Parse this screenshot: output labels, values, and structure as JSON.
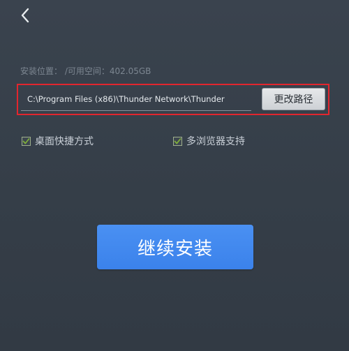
{
  "nav": {
    "back_icon": "chevron-left-icon"
  },
  "location": {
    "label": "安装位置：",
    "space_label": "/可用空间：402.05GB"
  },
  "path": {
    "value": "C:\\Program Files (x86)\\Thunder Network\\Thunder",
    "change_button": "更改路径",
    "highlight_color": "#e3262e"
  },
  "options": {
    "desktop_shortcut": {
      "label": "桌面快捷方式",
      "checked": true
    },
    "multi_browser": {
      "label": "多浏览器支持",
      "checked": true
    },
    "check_color": "#7fb03a"
  },
  "actions": {
    "continue_install": "继续安装",
    "accent_color": "#4a90f2"
  }
}
